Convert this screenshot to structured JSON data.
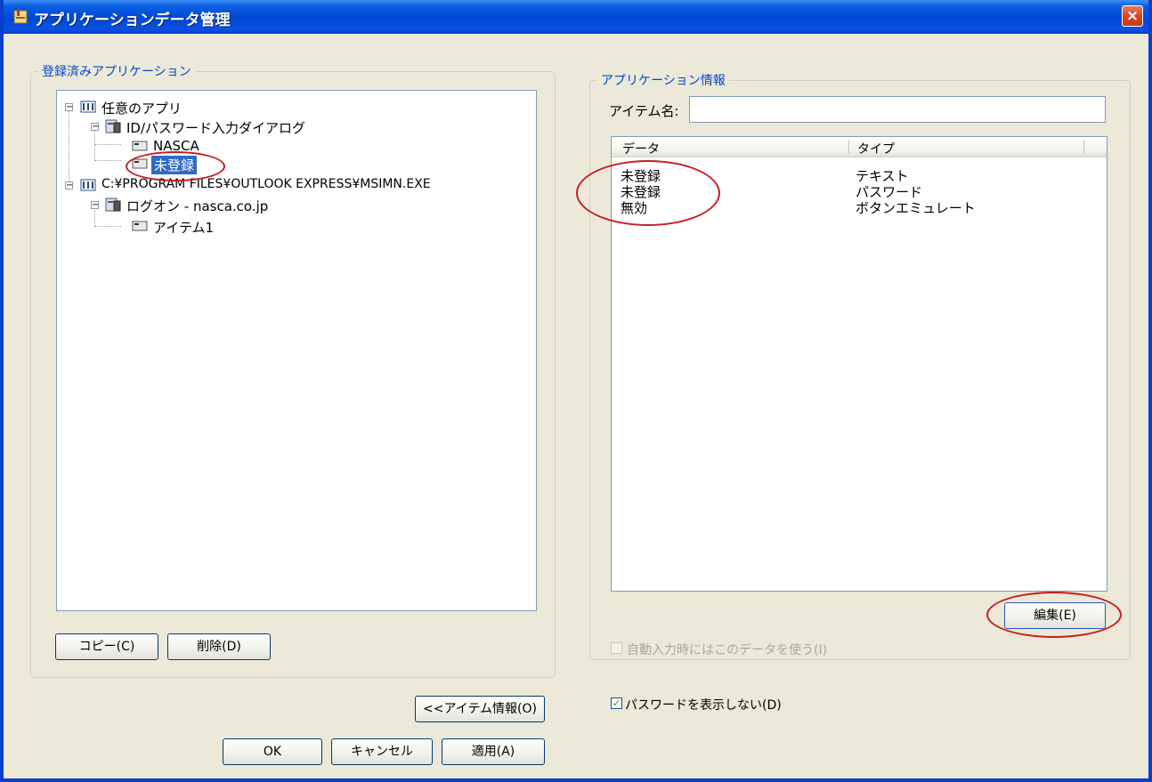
{
  "window": {
    "title": "アプリケーションデータ管理",
    "close_glyph": "×"
  },
  "left_panel": {
    "group_label": "登録済みアプリケーション",
    "tree": [
      {
        "label": "任意のアプリ",
        "expanded": true
      },
      {
        "label": "ID/パスワード入力ダイアログ",
        "expanded": true
      },
      {
        "label": "NASCA"
      },
      {
        "label": "未登録",
        "selected": true
      },
      {
        "label": "C:¥PROGRAM FILES¥OUTLOOK EXPRESS¥MSIMN.EXE",
        "expanded": true
      },
      {
        "label": "ログオン - nasca.co.jp",
        "expanded": true
      },
      {
        "label": "アイテム1"
      }
    ],
    "copy_button": "コピー(C)",
    "delete_button": "削除(D)"
  },
  "right_panel": {
    "group_label": "アプリケーション情報",
    "item_name_label": "アイテム名:",
    "item_name_value": "",
    "list": {
      "columns": [
        "データ",
        "タイプ"
      ],
      "rows": [
        {
          "data": "未登録",
          "type": "テキスト"
        },
        {
          "data": "未登録",
          "type": "パスワード"
        },
        {
          "data": "無効",
          "type": "ボタンエミュレート"
        }
      ]
    },
    "edit_button": "編集(E)",
    "auto_input_checkbox": {
      "label": "自動入力時にはこのデータを使う(I)",
      "checked": false,
      "enabled": false
    }
  },
  "bottom": {
    "item_info_button": "<<アイテム情報(O)",
    "hide_password_checkbox": {
      "label": "パスワードを表示しない(D)",
      "checked": true
    },
    "ok_button": "OK",
    "cancel_button": "キャンセル",
    "apply_button": "適用(A)"
  },
  "colors": {
    "title_bar": "#0a52e4",
    "group_label": "#0046d5",
    "selection": "#316ac5",
    "annotation": "#c81d1d",
    "dialog_bg": "#ece9d8"
  },
  "icons": {
    "title": "app-window-icon",
    "app_group": "app-group-icon",
    "dialog": "dialog-icon",
    "item": "text-field-icon",
    "expander": "minus-expander-icon"
  }
}
